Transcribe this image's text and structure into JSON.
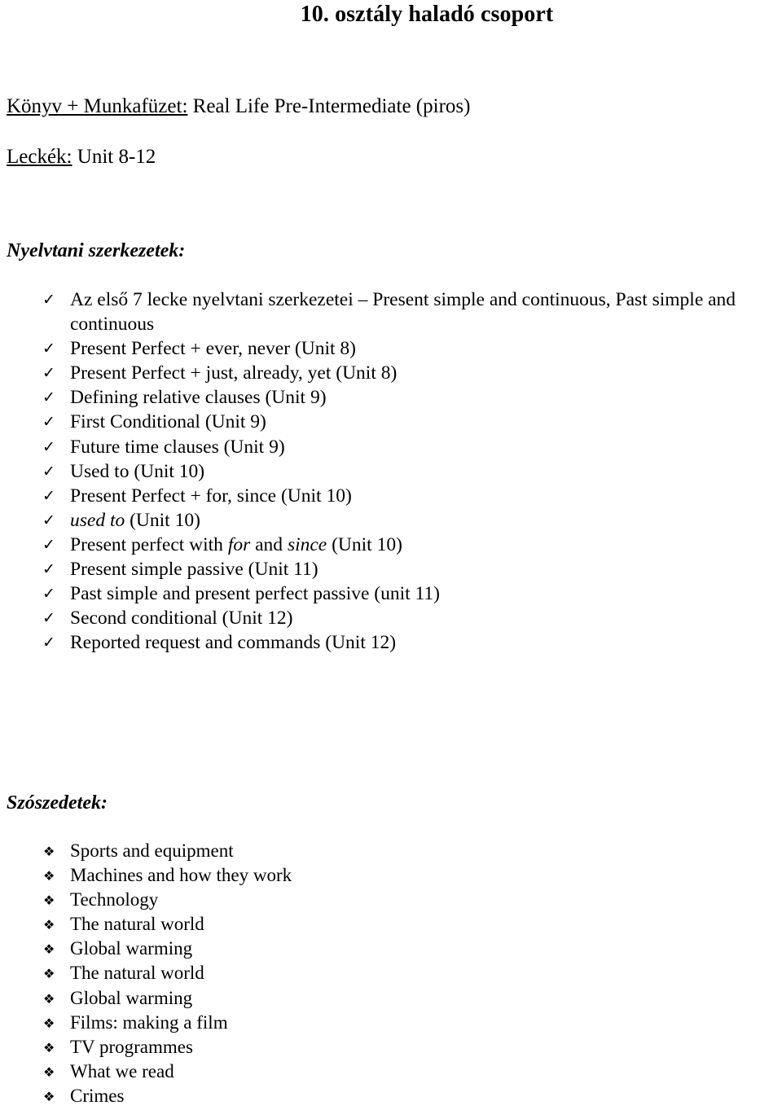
{
  "document": {
    "title": "10. osztály haladó csoport",
    "meta": [
      {
        "label": "Könyv + Munkafüzet:",
        "value": " Real Life Pre-Intermediate (piros)"
      },
      {
        "label": "Leckék:",
        "value": " Unit 8-12"
      }
    ],
    "sections": [
      {
        "heading": "Nyelvtani szerkezetek:",
        "bullet_icon": "checkmark-icon",
        "bullet_glyph": "✓",
        "items": [
          {
            "text": "Az első 7 lecke nyelvtani szerkezetei – Present simple and continuous, Past simple and continuous"
          },
          {
            "text": "Present Perfect + ever, never (Unit 8)"
          },
          {
            "text": "Present Perfect + just, already, yet (Unit 8)"
          },
          {
            "text": "Defining relative clauses (Unit 9)"
          },
          {
            "text": "First Conditional (Unit 9)"
          },
          {
            "text": "Future time clauses (Unit 9)"
          },
          {
            "text": "Used to (Unit 10)"
          },
          {
            "text": "Present Perfect + for, since (Unit 10)"
          },
          {
            "html": "<i>used to</i> (Unit 10)",
            "text": "used to (Unit 10)"
          },
          {
            "html": "Present perfect with <i>for</i> and <i>since</i> (Unit 10)",
            "text": "Present perfect with for and since (Unit 10)"
          },
          {
            "text": "Present simple passive (Unit 11)"
          },
          {
            "text": "Past simple and present perfect passive (unit 11)"
          },
          {
            "text": "Second conditional (Unit 12)"
          },
          {
            "text": "Reported request and commands (Unit 12)"
          }
        ]
      },
      {
        "heading": "Szószedetek:",
        "bullet_icon": "diamond-bullet-icon",
        "bullet_glyph": "❖",
        "items": [
          {
            "text": "Sports and equipment"
          },
          {
            "text": "Machines and how they work"
          },
          {
            "text": "Technology"
          },
          {
            "text": "The natural world"
          },
          {
            "text": "Global warming"
          },
          {
            "text": "The natural world"
          },
          {
            "text": "Global warming"
          },
          {
            "text": "Films: making a film"
          },
          {
            "text": "TV programmes"
          },
          {
            "text": "What we read"
          },
          {
            "text": "Crimes"
          }
        ]
      }
    ]
  }
}
